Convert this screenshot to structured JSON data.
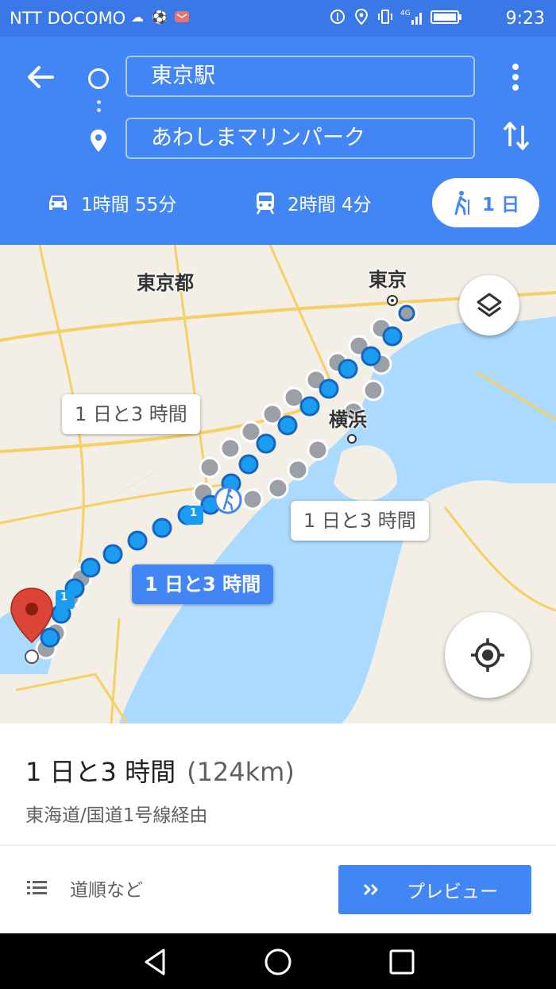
{
  "status_bar": {
    "carrier": "NTT DOCOMO",
    "signal": "4G",
    "time": "9:23",
    "icons": [
      "cloud-icon",
      "soccer-icon",
      "mail-icon",
      "data-saver-icon",
      "location-icon",
      "vibrate-icon",
      "signal-icon",
      "battery-icon"
    ]
  },
  "directions": {
    "origin": "東京駅",
    "destination": "あわしまマリンパーク"
  },
  "modes": [
    {
      "name": "car",
      "label": "1時間 55分"
    },
    {
      "name": "transit",
      "label": "2時間 4分"
    },
    {
      "name": "walk",
      "label": "1 日",
      "selected": true
    }
  ],
  "map": {
    "labels": {
      "tokyo_pref": "東京都",
      "tokyo_city": "東京",
      "yokohama": "横浜"
    },
    "route_bubbles": [
      {
        "text": "1 日と3 時間",
        "active": false
      },
      {
        "text": "1 日と3 時間",
        "active": false
      },
      {
        "text": "1 日と3 時間",
        "active": true
      }
    ],
    "route_marker_number": "1"
  },
  "sheet": {
    "duration": "1 日と3 時間",
    "distance": "(124km)",
    "via": "東海道/国道1号線経由",
    "steps_label": "道順など",
    "preview_label": "プレビュー"
  },
  "colors": {
    "header": "#4285f4",
    "status_bar": "#3b78e7",
    "route_active": "#1a9cf0",
    "route_alt": "#9aa0a6",
    "water": "#aadaff",
    "marker": "#db4437"
  }
}
